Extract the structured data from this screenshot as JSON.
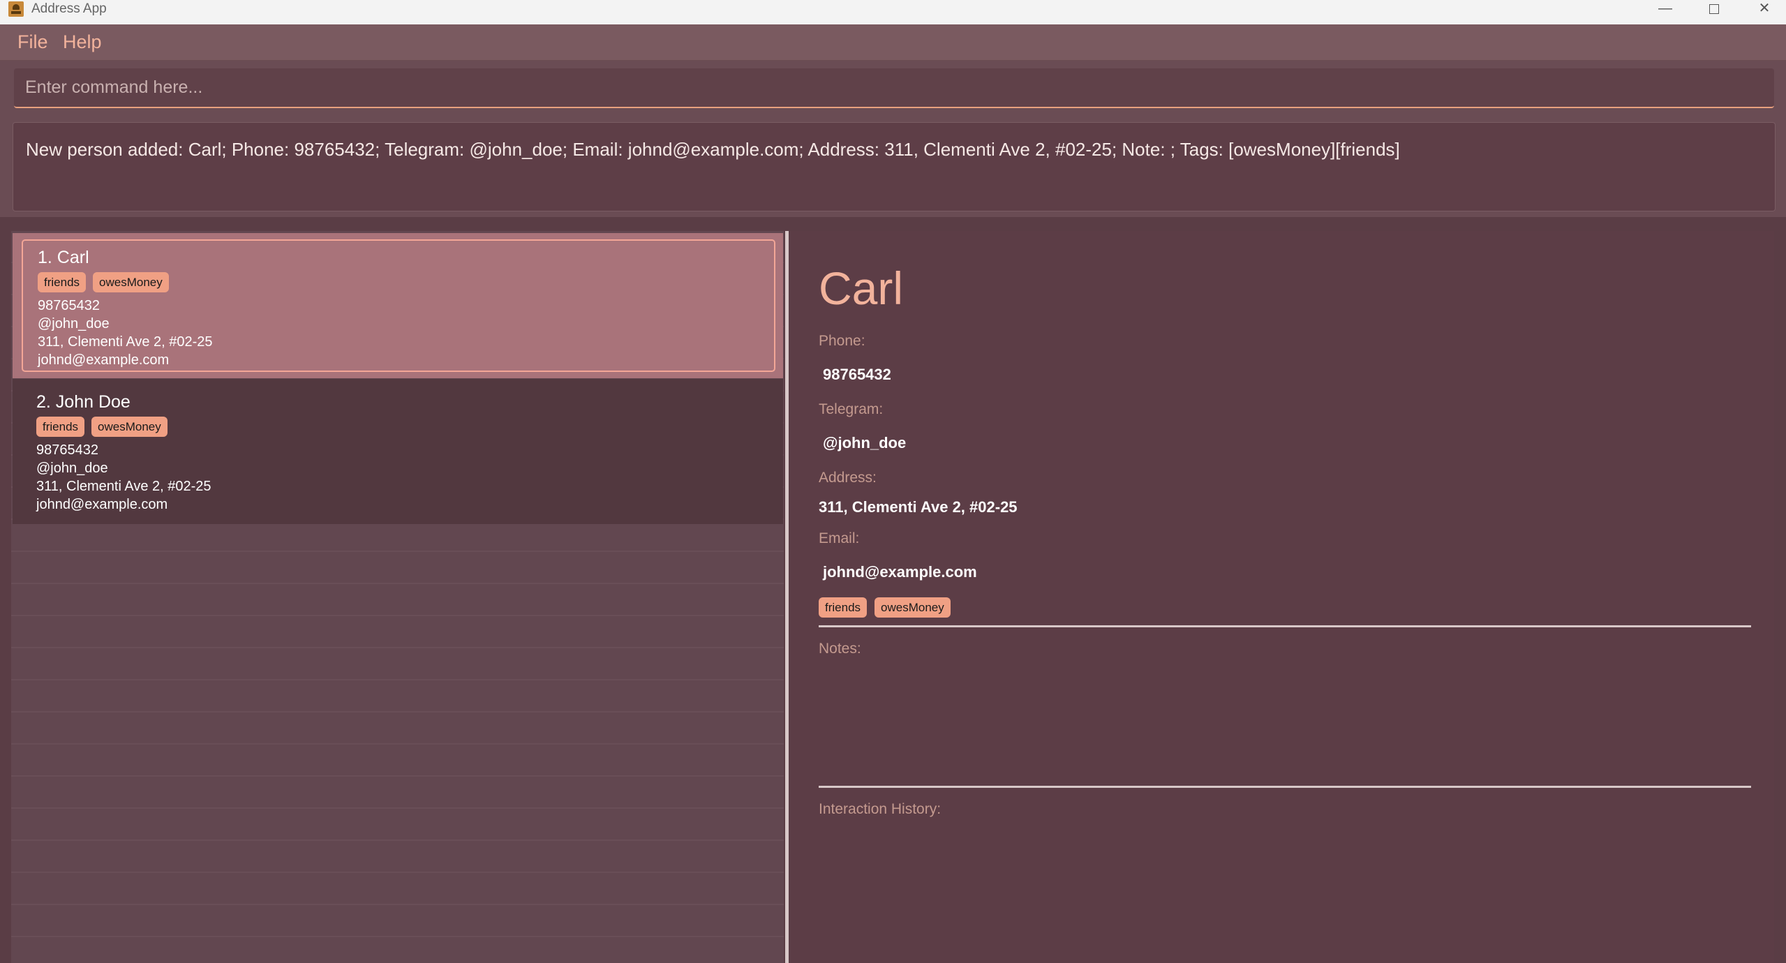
{
  "window": {
    "title": "Address App",
    "controls": {
      "minimize": "—",
      "close": "✕"
    }
  },
  "menu": {
    "file": "File",
    "help": "Help"
  },
  "command": {
    "placeholder": "Enter command here...",
    "value": ""
  },
  "result": {
    "text": "New person added: Carl; Phone: 98765432; Telegram: @john_doe; Email: johnd@example.com; Address: 311, Clementi Ave 2, #02-25; Note: ; Tags: [owesMoney][friends]"
  },
  "persons": [
    {
      "index_name": "1.  Carl",
      "tags": [
        "friends",
        "owesMoney"
      ],
      "phone": "98765432",
      "telegram": "@john_doe",
      "address": "311, Clementi Ave 2, #02-25",
      "email": "johnd@example.com",
      "selected": true
    },
    {
      "index_name": "2.  John Doe",
      "tags": [
        "friends",
        "owesMoney"
      ],
      "phone": "98765432",
      "telegram": "@john_doe",
      "address": "311, Clementi Ave 2, #02-25",
      "email": "johnd@example.com",
      "selected": false
    }
  ],
  "detail": {
    "name": "Carl",
    "phone_label": "Phone:",
    "phone": "98765432",
    "telegram_label": "Telegram:",
    "telegram": "@john_doe",
    "address_label": "Address:",
    "address": "311, Clementi Ave 2, #02-25",
    "email_label": "Email:",
    "email": "johnd@example.com",
    "tags": [
      "friends",
      "owesMoney"
    ],
    "notes_label": "Notes:",
    "history_label": "Interaction History:"
  },
  "colors": {
    "accent": "#f2b39c",
    "tag_bg": "#f0a084",
    "selected_card": "#a9737a",
    "background": "#5c3d46"
  }
}
